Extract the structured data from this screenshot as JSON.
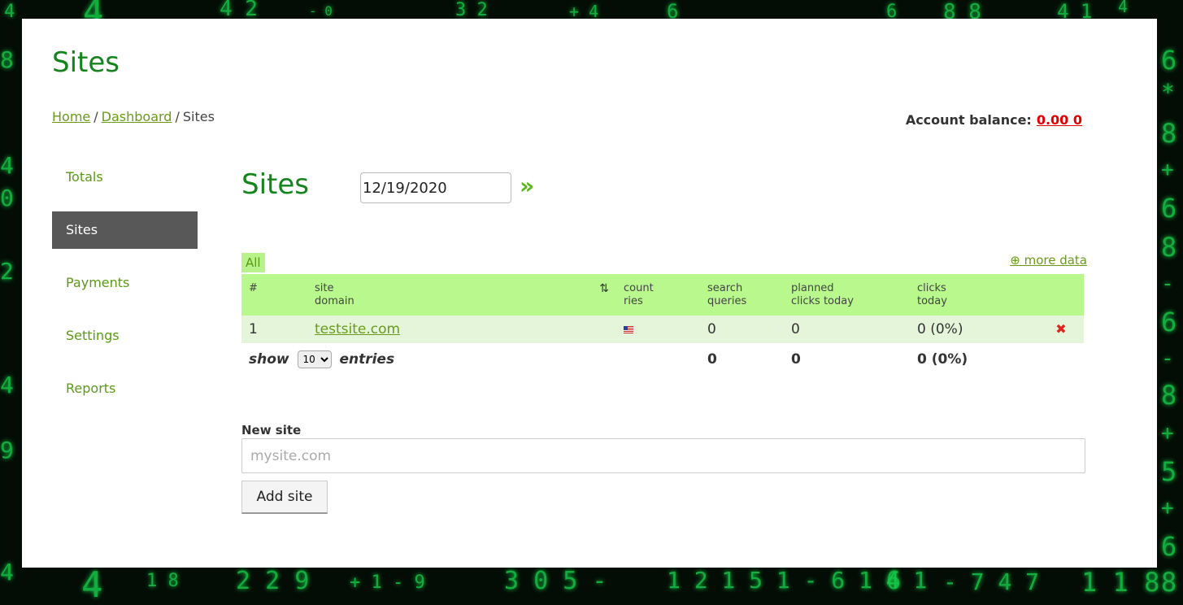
{
  "page": {
    "title": "Sites",
    "breadcrumb": {
      "home": "Home",
      "dashboard": "Dashboard",
      "current": "Sites",
      "separator": "/"
    },
    "balance": {
      "label": "Account balance:",
      "value": "0.00 0"
    }
  },
  "sidebar": {
    "items": [
      {
        "label": "Totals",
        "active": false
      },
      {
        "label": "Sites",
        "active": true
      },
      {
        "label": "Payments",
        "active": false
      },
      {
        "label": "Settings",
        "active": false
      },
      {
        "label": "Reports",
        "active": false
      }
    ]
  },
  "main": {
    "title": "Sites",
    "date": "12/19/2020",
    "go_icon": "double-chevron-right-icon",
    "filter_all": "All",
    "more_data": "⊕ more data",
    "table": {
      "columns": [
        "#",
        "site\ndomain",
        "count\nries",
        "search\nqueries",
        "planned\nclicks today",
        "clicks\ntoday"
      ],
      "sort_icon": "⇅",
      "rows": [
        {
          "num": "1",
          "domain": "testsite.com",
          "country_flag": "us-flag-icon",
          "search_queries": "0",
          "planned_clicks": "0",
          "clicks_today": "0 (0%)",
          "delete_icon": "✖"
        }
      ],
      "footer": {
        "show_label": "show",
        "entries_value": "10",
        "entries_label": "entries",
        "search_queries_total": "0",
        "planned_clicks_total": "0",
        "clicks_today_total": "0 (0%)"
      }
    },
    "new_site": {
      "label": "New site",
      "placeholder": "mysite.com",
      "button": "Add site"
    }
  },
  "colors": {
    "brand_green": "#16841c",
    "link_green": "#6a9a1a",
    "table_header_bg": "#b8f88c",
    "row_bg": "#e4f5da",
    "active_nav_bg": "#585858",
    "balance_red": "#e00000"
  }
}
